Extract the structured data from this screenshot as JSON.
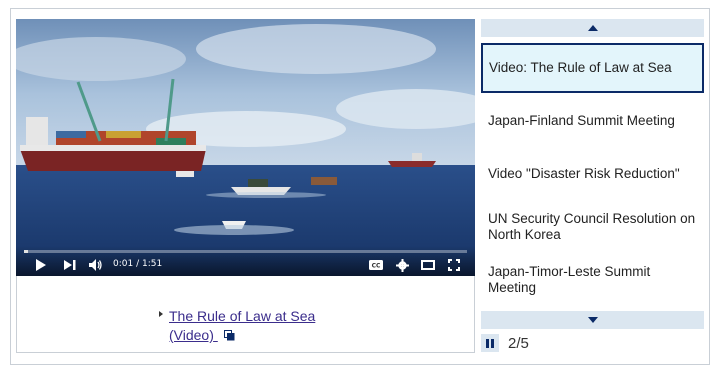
{
  "video": {
    "time": "0:01 / 1:51",
    "progress": 0.009,
    "icons": [
      "play-icon",
      "next-icon",
      "volume-icon",
      "cc-icon",
      "settings-gear-icon",
      "theater-mode-icon",
      "fullscreen-icon"
    ]
  },
  "caption": {
    "line1": "The Rule of Law at Sea",
    "line2": "(Video)",
    "icon": "external-window-icon"
  },
  "playlist": {
    "items": [
      {
        "label": "Video: The Rule of Law at Sea",
        "active": true
      },
      {
        "label": "Japan-Finland Summit Meeting",
        "active": false
      },
      {
        "label": "Video \"Disaster Risk Reduction\"",
        "active": false
      },
      {
        "label": "UN Security Council Resolution on North Korea",
        "active": false
      },
      {
        "label": "Japan-Timor-Leste Summit Meeting",
        "active": false
      }
    ],
    "counter": "2/5"
  },
  "colors": {
    "accent": "#0b2a67",
    "active_bg": "#e3f5fb",
    "button_bg": "#dbe6f0",
    "link": "#3b2d8c"
  }
}
